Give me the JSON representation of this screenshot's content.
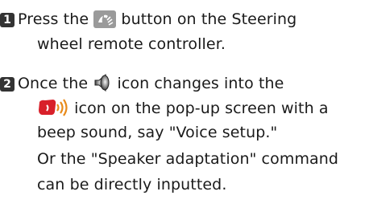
{
  "step1": {
    "number": "1",
    "line1_part1": "Press the",
    "button_icon": "voice-recognition-button-icon",
    "line1_part2": "button on the Steering",
    "line2": "wheel remote controller."
  },
  "step2": {
    "number": "2",
    "line1_part1": "Once the",
    "speaker_icon": "speaker-icon",
    "line1_part2": "icon changes into the",
    "talk_icon": "voice-talk-icon",
    "line2_part2": "icon on the pop-up screen with a",
    "line3": "beep sound, say \"Voice setup.\"",
    "line4": "Or the \"Speaker adaptation\" command",
    "line5": "can be directly inputted."
  },
  "colors": {
    "button_icon_bg": "#9a9a9a",
    "talk_icon_red": "#d8202a",
    "talk_waves_orange": "#e88a1a",
    "number_badge": "#333333"
  }
}
